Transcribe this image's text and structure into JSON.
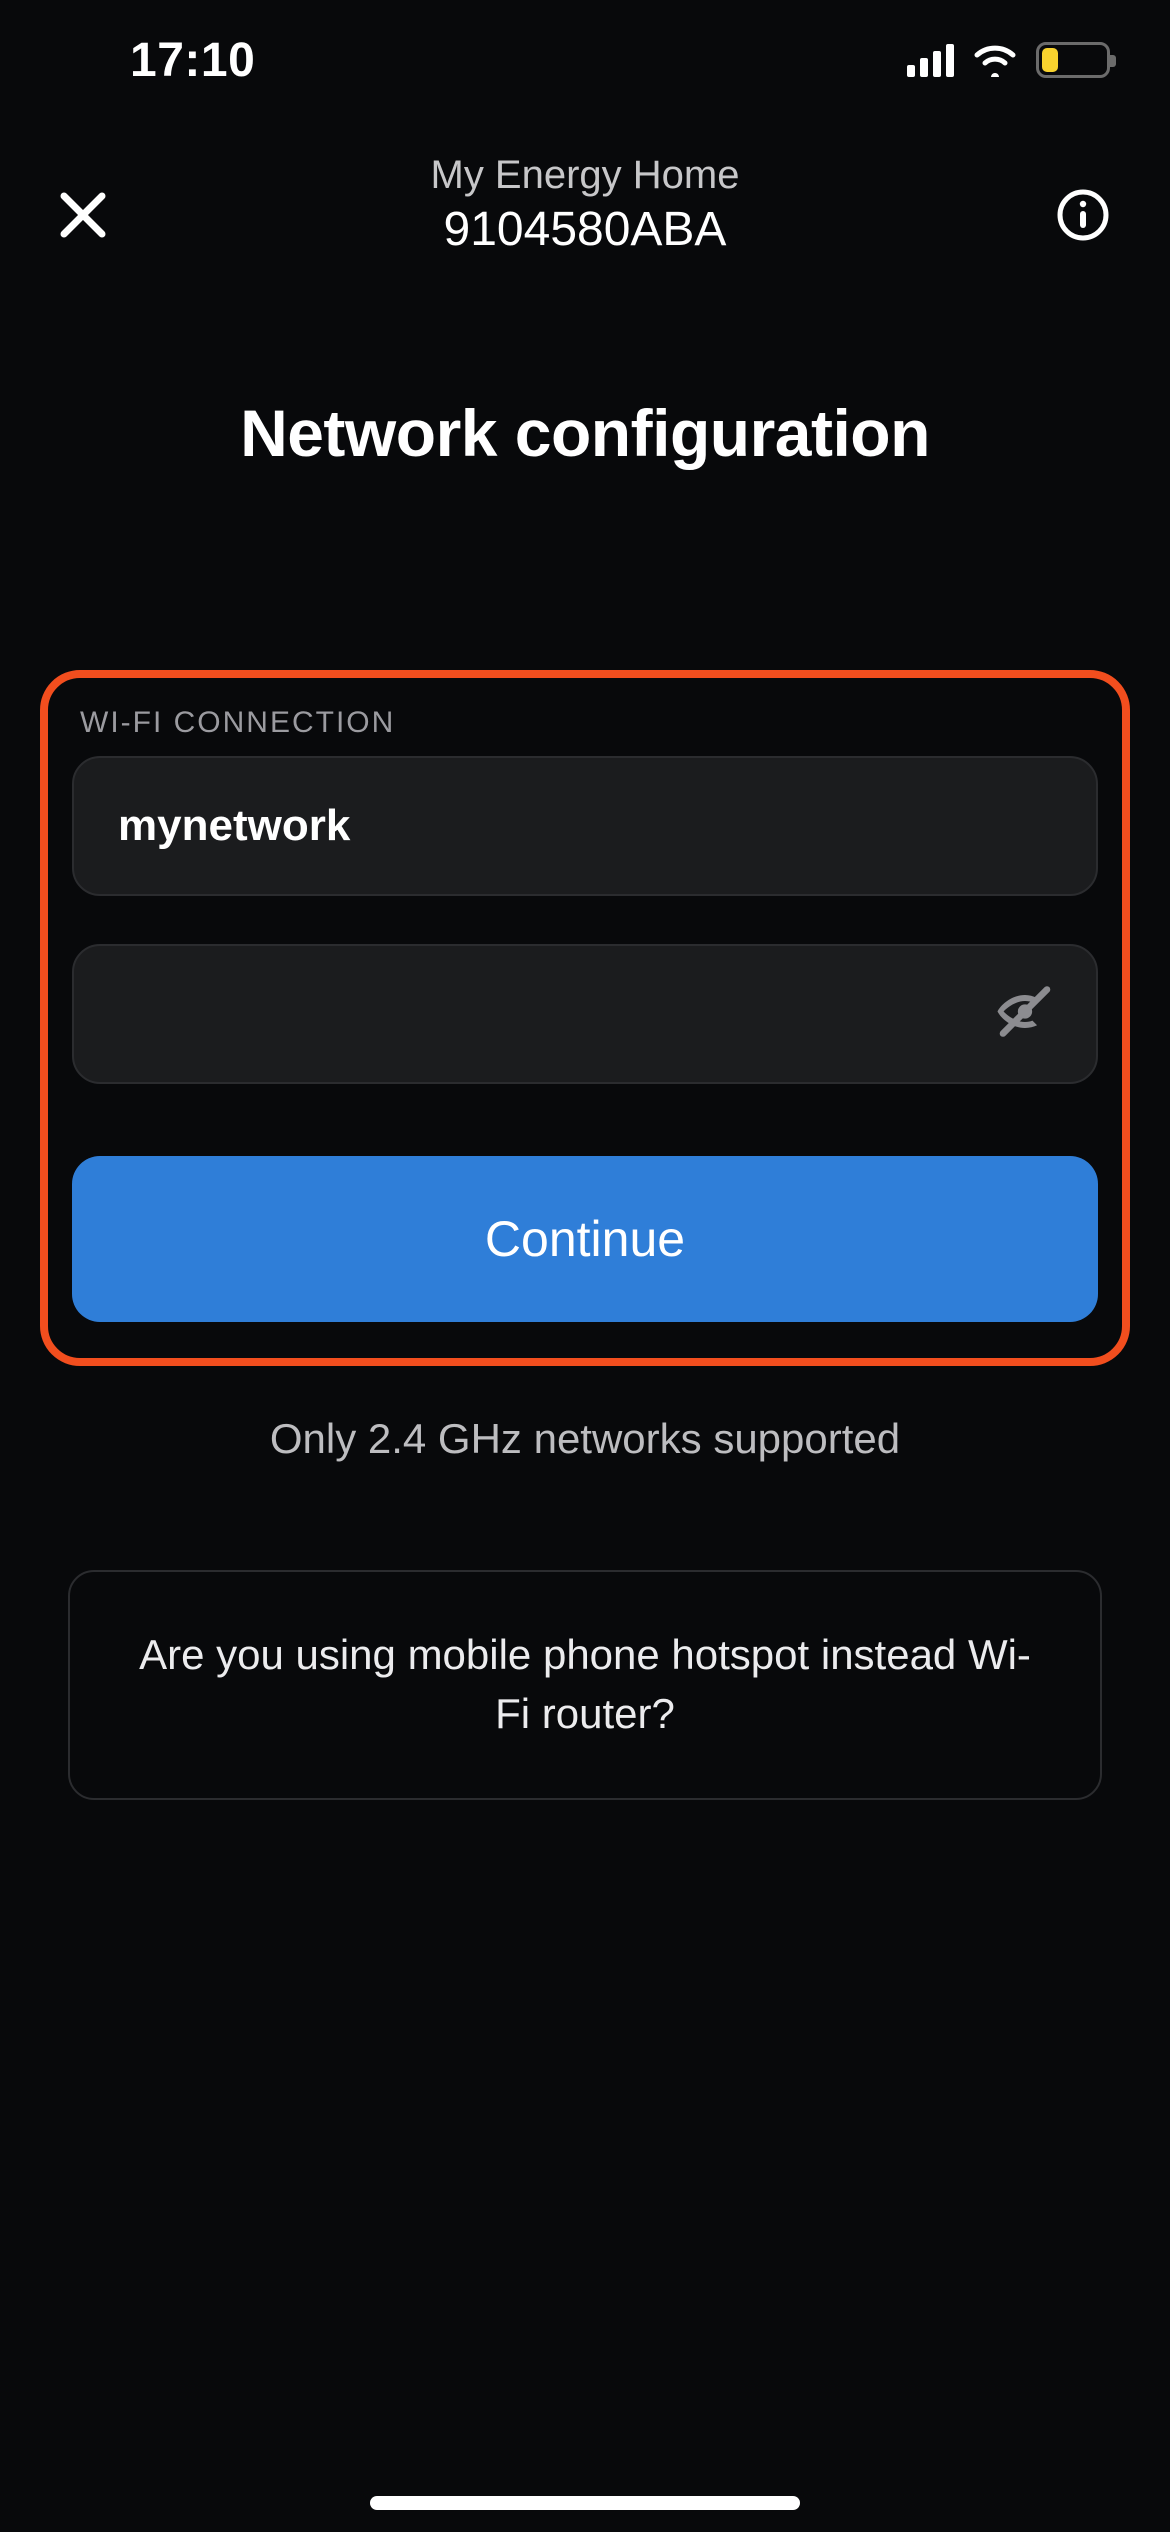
{
  "status": {
    "time": "17:10"
  },
  "nav": {
    "title": "My Energy Home",
    "subtitle": "9104580ABA"
  },
  "page": {
    "heading": "Network configuration"
  },
  "wifi": {
    "section_label": "WI-FI CONNECTION",
    "ssid_value": "mynetwork",
    "ssid_placeholder": "",
    "password_value": "",
    "password_placeholder": "",
    "continue_label": "Continue",
    "hint": "Only 2.4 GHz networks supported"
  },
  "hotspot": {
    "prompt": "Are you using mobile phone hotspot instead Wi-Fi router?"
  }
}
